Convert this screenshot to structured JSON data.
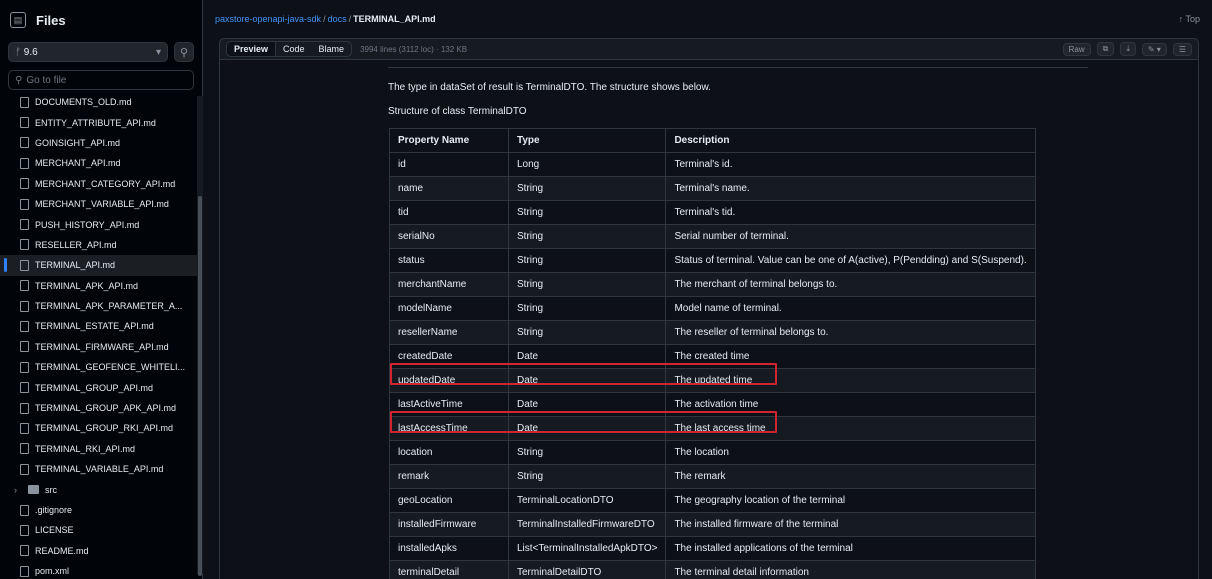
{
  "sidebar": {
    "title": "Files",
    "branch": "9.6",
    "goto_placeholder": "Go to file",
    "items": [
      {
        "label": "DOCUMENTS_OLD.md",
        "type": "file"
      },
      {
        "label": "ENTITY_ATTRIBUTE_API.md",
        "type": "file"
      },
      {
        "label": "GOINSIGHT_API.md",
        "type": "file"
      },
      {
        "label": "MERCHANT_API.md",
        "type": "file"
      },
      {
        "label": "MERCHANT_CATEGORY_API.md",
        "type": "file"
      },
      {
        "label": "MERCHANT_VARIABLE_API.md",
        "type": "file"
      },
      {
        "label": "PUSH_HISTORY_API.md",
        "type": "file"
      },
      {
        "label": "RESELLER_API.md",
        "type": "file"
      },
      {
        "label": "TERMINAL_API.md",
        "type": "file"
      },
      {
        "label": "TERMINAL_APK_API.md",
        "type": "file"
      },
      {
        "label": "TERMINAL_APK_PARAMETER_A...",
        "type": "file"
      },
      {
        "label": "TERMINAL_ESTATE_API.md",
        "type": "file"
      },
      {
        "label": "TERMINAL_FIRMWARE_API.md",
        "type": "file"
      },
      {
        "label": "TERMINAL_GEOFENCE_WHITELI...",
        "type": "file"
      },
      {
        "label": "TERMINAL_GROUP_API.md",
        "type": "file"
      },
      {
        "label": "TERMINAL_GROUP_APK_API.md",
        "type": "file"
      },
      {
        "label": "TERMINAL_GROUP_RKI_API.md",
        "type": "file"
      },
      {
        "label": "TERMINAL_RKI_API.md",
        "type": "file"
      },
      {
        "label": "TERMINAL_VARIABLE_API.md",
        "type": "file"
      },
      {
        "label": "src",
        "type": "folder"
      },
      {
        "label": ".gitignore",
        "type": "file"
      },
      {
        "label": "LICENSE",
        "type": "file"
      },
      {
        "label": "README.md",
        "type": "file"
      },
      {
        "label": "pom.xml",
        "type": "file"
      }
    ]
  },
  "breadcrumb": {
    "repo": "paxstore-openapi-java-sdk",
    "folder": "docs",
    "file": "TERMINAL_API.md",
    "top": "↑ Top"
  },
  "file_header": {
    "tabs": [
      "Preview",
      "Code",
      "Blame"
    ],
    "meta": "3994 lines (3112 loc) · 132 KB",
    "raw": "Raw"
  },
  "content": {
    "para1": "The type in dataSet of result is TerminalDTO. The structure shows below.",
    "para2": "Structure of class TerminalDTO",
    "headers": [
      "Property Name",
      "Type",
      "Description"
    ],
    "rows": [
      [
        "id",
        "Long",
        "Terminal's id."
      ],
      [
        "name",
        "String",
        "Terminal's name."
      ],
      [
        "tid",
        "String",
        "Terminal's tid."
      ],
      [
        "serialNo",
        "String",
        "Serial number of terminal."
      ],
      [
        "status",
        "String",
        "Status of terminal. Value can be one of A(active), P(Pendding) and S(Suspend)."
      ],
      [
        "merchantName",
        "String",
        "The merchant of terminal belongs to."
      ],
      [
        "modelName",
        "String",
        "Model name of terminal."
      ],
      [
        "resellerName",
        "String",
        "The reseller of terminal belongs to."
      ],
      [
        "createdDate",
        "Date",
        "The created time"
      ],
      [
        "updatedDate",
        "Date",
        "The updated time"
      ],
      [
        "lastActiveTime",
        "Date",
        "The activation time"
      ],
      [
        "lastAccessTime",
        "Date",
        "The last access time"
      ],
      [
        "location",
        "String",
        "The location"
      ],
      [
        "remark",
        "String",
        "The remark"
      ],
      [
        "geoLocation",
        "TerminalLocationDTO",
        "The geography location of the terminal"
      ],
      [
        "installedFirmware",
        "TerminalInstalledFirmwareDTO",
        "The installed firmware of the terminal"
      ],
      [
        "installedApks",
        "List<TerminalInstalledApkDTO>",
        "The installed applications of the terminal"
      ],
      [
        "terminalDetail",
        "TerminalDetailDTO",
        "The terminal detail information"
      ]
    ]
  }
}
